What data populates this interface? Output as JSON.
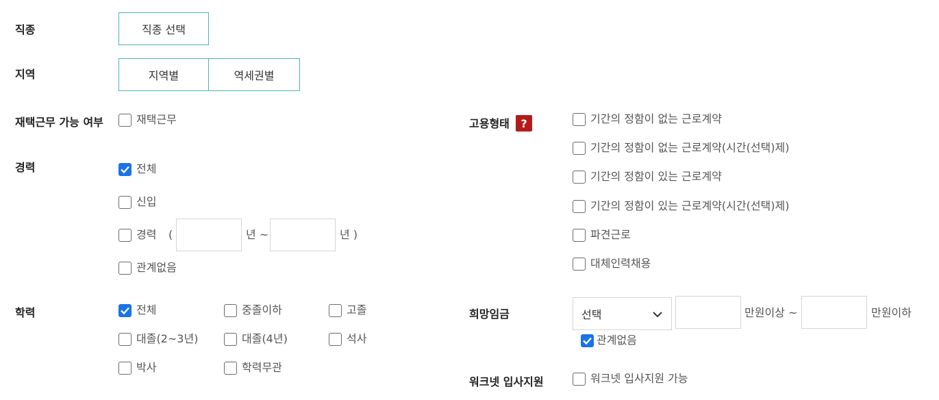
{
  "job_type": {
    "label": "직종",
    "button": "직종 선택"
  },
  "region": {
    "label": "지역",
    "by_region": "지역별",
    "by_station": "역세권별"
  },
  "remote": {
    "label": "재택근무 가능 여부",
    "option": "재택근무",
    "checked": false
  },
  "career": {
    "label": "경력",
    "options": [
      {
        "text": "전체",
        "checked": true
      },
      {
        "text": "신입",
        "checked": false
      },
      {
        "text": "경력",
        "checked": false
      },
      {
        "text": "관계없음",
        "checked": false
      }
    ],
    "open_paren": "(",
    "from_unit": "년 ~",
    "to_unit": "년 )",
    "from_value": "",
    "to_value": ""
  },
  "education": {
    "label": "학력",
    "options": [
      {
        "text": "전체",
        "checked": true
      },
      {
        "text": "중졸이하",
        "checked": false
      },
      {
        "text": "고졸",
        "checked": false
      },
      {
        "text": "대졸(2~3년)",
        "checked": false
      },
      {
        "text": "대졸(4년)",
        "checked": false
      },
      {
        "text": "석사",
        "checked": false
      },
      {
        "text": "박사",
        "checked": false
      },
      {
        "text": "학력무관",
        "checked": false
      }
    ]
  },
  "employment": {
    "label": "고용형태",
    "help": "?",
    "options": [
      {
        "text": "기간의 정함이 없는 근로계약",
        "checked": false
      },
      {
        "text": "기간의 정함이 없는 근로계약(시간(선택)제)",
        "checked": false
      },
      {
        "text": "기간의 정함이 있는 근로계약",
        "checked": false
      },
      {
        "text": "기간의 정함이 있는 근로계약(시간(선택)제)",
        "checked": false
      },
      {
        "text": "파견근로",
        "checked": false
      },
      {
        "text": "대체인력채용",
        "checked": false
      }
    ]
  },
  "salary": {
    "label": "희망임금",
    "select_value": "선택",
    "min_unit": "만원이상 ~",
    "max_unit": "만원이하",
    "min_value": "",
    "max_value": "",
    "any": {
      "text": "관계없음",
      "checked": true
    }
  },
  "worknet": {
    "label": "워크넷 입사지원",
    "option": "워크넷 입사지원 가능",
    "checked": false
  }
}
